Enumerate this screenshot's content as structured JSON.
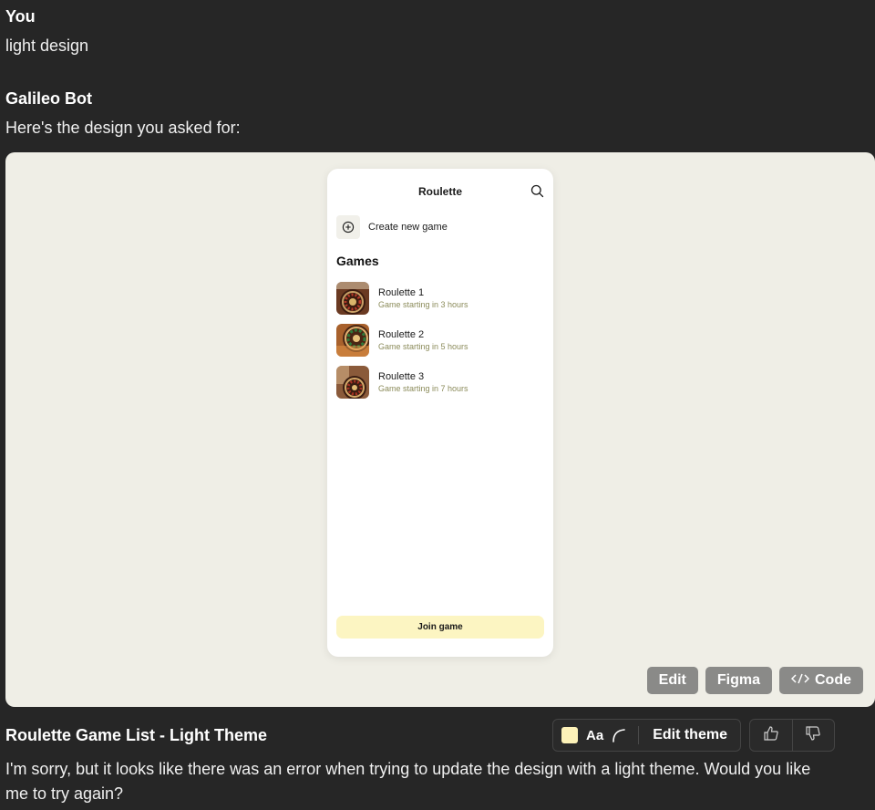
{
  "conversation": {
    "user_author": "You",
    "user_message": "light design",
    "bot_author": "Galileo Bot",
    "bot_message": "Here's the design you asked for:"
  },
  "preview": {
    "title": "Roulette",
    "create_label": "Create new game",
    "games_heading": "Games",
    "games": [
      {
        "name": "Roulette 1",
        "subtitle": "Game starting in 3 hours"
      },
      {
        "name": "Roulette 2",
        "subtitle": "Game starting in 5 hours"
      },
      {
        "name": "Roulette 3",
        "subtitle": "Game starting in 7 hours"
      }
    ],
    "join_label": "Join game",
    "colors": {
      "canvas_bg": "#efeee6",
      "accent": "#fcf5c2",
      "subtitle": "#8b8b5a"
    }
  },
  "canvas_actions": {
    "edit_label": "Edit",
    "figma_label": "Figma",
    "code_label": "Code"
  },
  "footer": {
    "design_title": "Roulette Game List - Light Theme",
    "font_label": "Aa",
    "edit_theme_label": "Edit theme",
    "message": "I'm sorry, but it looks like there was an error when trying to update the design with a light theme. Would you like me to try again?"
  }
}
